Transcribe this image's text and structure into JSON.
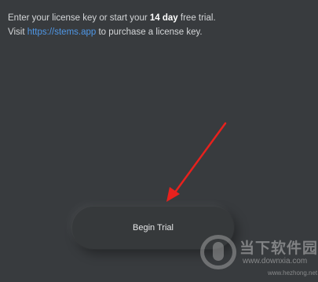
{
  "intro": {
    "line1_prefix": "Enter your license key or start your ",
    "line1_bold": "14 day",
    "line1_suffix": " free trial.",
    "line2_prefix": "Visit ",
    "line2_link": "https://stems.app",
    "line2_suffix": " to purchase a license key."
  },
  "button": {
    "label": "Begin Trial"
  },
  "annotation": {
    "arrow_color": "#e8211d"
  },
  "watermark": {
    "cn_text": "当下软件园",
    "url_text": "www.downxia.com",
    "url2_text": "www.hezhong.net"
  },
  "colors": {
    "background": "#383b3e",
    "link": "#4f97e6",
    "text": "#d4d6d8"
  }
}
